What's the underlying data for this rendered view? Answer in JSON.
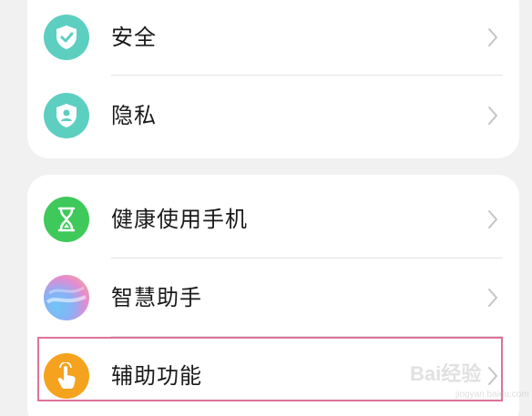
{
  "groups": [
    {
      "items": [
        {
          "label": "安全",
          "icon": "shield-check-icon",
          "color": "#5ccfc0"
        },
        {
          "label": "隐私",
          "icon": "shield-person-icon",
          "color": "#5ccfc0"
        }
      ]
    },
    {
      "items": [
        {
          "label": "健康使用手机",
          "icon": "hourglass-icon",
          "color": "#3ec95a"
        },
        {
          "label": "智慧助手",
          "icon": "gradient-orb-icon",
          "color": "#b48cf0"
        },
        {
          "label": "辅助功能",
          "icon": "hand-tap-icon",
          "color": "#f5a21e"
        }
      ]
    }
  ],
  "highlight_color": "#e0719a",
  "watermark": {
    "text": "Bai经验",
    "sub": "jingyan.baidu.com"
  }
}
